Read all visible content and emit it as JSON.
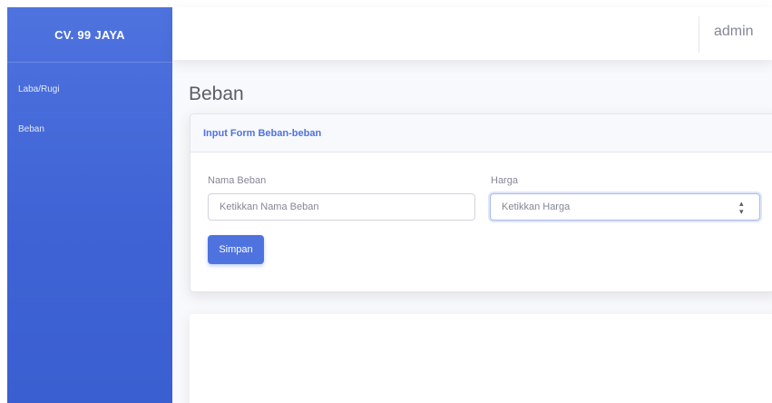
{
  "sidebar": {
    "brand": "CV. 99 JAYA",
    "items": [
      {
        "label": "Laba/Rugi"
      },
      {
        "label": "Beban"
      }
    ]
  },
  "topbar": {
    "user_name": "admin"
  },
  "page": {
    "title": "Beban"
  },
  "form_card": {
    "header": "Input Form Beban-beban",
    "name_field": {
      "label": "Nama Beban",
      "placeholder": "Ketikkan Nama Beban",
      "value": ""
    },
    "price_field": {
      "label": "Harga",
      "placeholder": "Ketikkan Harga",
      "value": ""
    },
    "submit_label": "Simpan"
  },
  "colors": {
    "primary": "#4e73df",
    "page_background": "#f8f9fc",
    "text_muted": "#858796"
  }
}
